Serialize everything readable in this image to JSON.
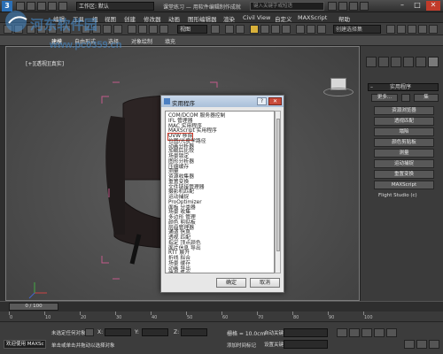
{
  "titlebar": {
    "workspace_label": "工作区: 默认",
    "workspace_value": "工作区: 默认",
    "document_title": "课堂练习 — 用软件编辑制作成就",
    "search_placeholder": "键入关键字或短语",
    "min": "–",
    "max": "□",
    "close": "✕"
  },
  "menu": {
    "items": [
      "编辑",
      "工具",
      "组",
      "视图",
      "创建",
      "修改器",
      "动画",
      "图形编辑器",
      "渲染",
      "Civil View",
      "自定义",
      "MAXScript",
      "帮助"
    ]
  },
  "toolbar": {
    "view_dropdown": "视图",
    "selection_set": "创建选择集"
  },
  "ribbon": {
    "tabs": [
      "建模",
      "自由形式",
      "选择",
      "对象绘制",
      "填充"
    ]
  },
  "viewport": {
    "label": "[+][透视][真实]"
  },
  "watermark": {
    "brand": "河东软件园",
    "url": "www.pc0359.cn"
  },
  "command_panel": {
    "header": "实用程序",
    "more": "更多...",
    "sets": "集",
    "buttons": [
      "资源浏览器",
      "透视匹配",
      "塌陷",
      "颜色剪贴板",
      "测量",
      "运动捕捉",
      "重置变换",
      "MAXScript",
      "Flight Studio (c)"
    ]
  },
  "dialog": {
    "title": "实用程序",
    "help": "?",
    "close": "✕",
    "items": [
      "COM/DCOM 服务器控制",
      "IFL 管理器",
      "MAC 实用程序",
      "MAXScript 实用程序",
      "UVW 移除",
      "位图/光度学路径",
      "动画分析器",
      "加载后比较",
      "场景锁定",
      "图形分析器",
      "压缩缓存",
      "测量",
      "资源收集器",
      "重置变换",
      "文件链接管理器",
      "摄影机匹配",
      "运动捕捉",
      "ProOptimizer",
      "面板 分类器",
      "场景 收集",
      "多边形 管理",
      "颜色 剪贴板",
      "层级管理器",
      "通道 信息",
      "透视 匹配",
      "指定 顶点颜色",
      "面片信息 导出",
      "RTT 展开",
      "折线 拟合",
      "场景 缓存",
      "动画 导出",
      "信息 集合"
    ],
    "highlighted_index": 4,
    "ok": "确定",
    "cancel": "取消"
  },
  "timeline": {
    "slider": "0 / 100",
    "ticks": [
      "0",
      "10",
      "20",
      "30",
      "40",
      "50",
      "60",
      "70",
      "80",
      "90",
      "100"
    ]
  },
  "statusbar": {
    "welcome": "欢迎使用 MAXSc",
    "selection": "未选定任何对象",
    "prompt": "单击或单击并拖动以选择对象",
    "x_label": "X:",
    "y_label": "Y:",
    "z_label": "Z:",
    "grid": "栅格 = 10.0cm",
    "add_time_tag": "添加时间标记",
    "auto_key": "自动关键点",
    "set_key": "设置关键点"
  }
}
